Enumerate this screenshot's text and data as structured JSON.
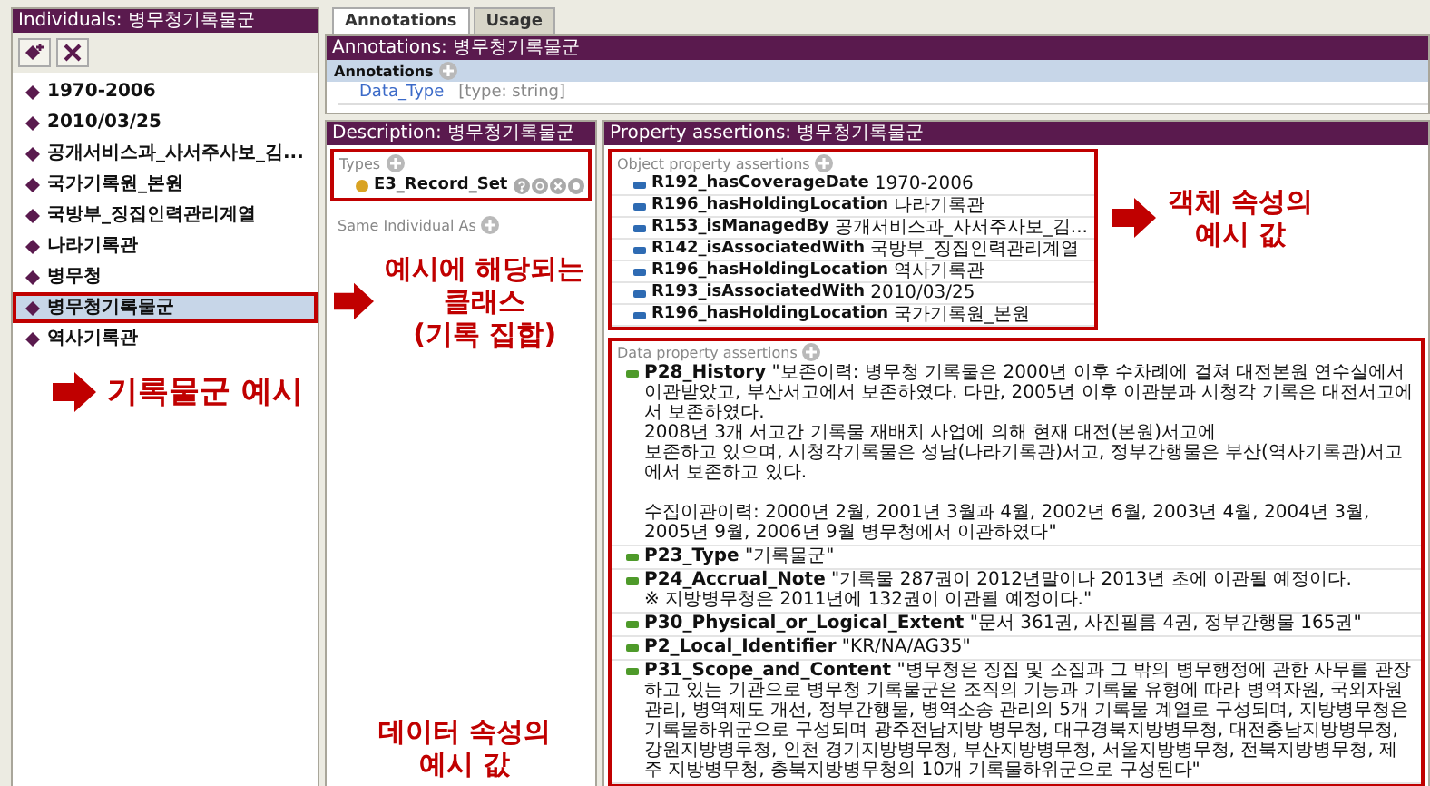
{
  "individuals": {
    "title": "Individuals: 병무청기록물군",
    "frame_selected": true,
    "items": [
      {
        "label": "1970-2006",
        "selected": false
      },
      {
        "label": "2010/03/25",
        "selected": false
      },
      {
        "label": "공개서비스과_사서주사보_김...",
        "selected": false
      },
      {
        "label": "국가기록원_본원",
        "selected": false
      },
      {
        "label": "국방부_징집인력관리계열",
        "selected": false
      },
      {
        "label": "나라기록관",
        "selected": false
      },
      {
        "label": "병무청",
        "selected": false
      },
      {
        "label": "병무청기록물군",
        "selected": true
      },
      {
        "label": "역사기록관",
        "selected": false
      }
    ],
    "callout": {
      "text": "기록물군 예시",
      "arrow": true
    }
  },
  "annotations_view": {
    "tabs": [
      {
        "label": "Annotations",
        "selected": true
      },
      {
        "label": "Usage",
        "selected": false
      }
    ],
    "title": "Annotations: 병무청기록물군",
    "section": "Annotations",
    "rows": [
      {
        "property": "Data_Type",
        "value": "[type: string]"
      }
    ]
  },
  "description": {
    "title": "Description: 병무청기록물군",
    "types": {
      "label": "Types",
      "framed": true,
      "items": [
        "E3_Record_Set"
      ]
    },
    "same_individual": "Same Individual As",
    "callout": {
      "text": "예시에 해당되는\n클래스\n(기록 집합)",
      "arrow": true
    },
    "bottom_callout": {
      "text": "데이터 속성의\n예시 값",
      "arrow": false
    }
  },
  "property_assertions": {
    "title": "Property assertions: 병무청기록물군",
    "object": {
      "label": "Object property assertions",
      "framed": true,
      "rows": [
        {
          "property": "R192_hasCoverageDate",
          "value": "1970-2006"
        },
        {
          "property": "R196_hasHoldingLocation",
          "value": "나라기록관"
        },
        {
          "property": "R153_isManagedBy",
          "value": "공개서비스과_사서주사보_김..."
        },
        {
          "property": "R142_isAssociatedWith",
          "value": "국방부_징집인력관리계열"
        },
        {
          "property": "R196_hasHoldingLocation",
          "value": "역사기록관"
        },
        {
          "property": "R193_isAssociatedWith",
          "value": "2010/03/25"
        },
        {
          "property": "R196_hasHoldingLocation",
          "value": "국가기록원_본원"
        }
      ]
    },
    "object_callout": {
      "text": "객체 속성의\n예시 값",
      "arrow": true
    },
    "data": {
      "label": "Data property assertions",
      "framed": true,
      "rows": [
        "**P28_History** \"보존이력: 병무청 기록물은 2000년 이후 수차례에 걸쳐 대전본원 연수실에서 이관받았고, 부산서고에서 보존하였다. 다만, 2005년 이후 이관분과 시청각 기록은 대전서고에서 보존하였다.\n2008년 3개 서고간 기록물 재배치 사업에 의해 현재 대전(본원)서고에\n보존하고 있으며, 시청각기록물은 성남(나라기록관)서고, 정부간행물은 부산(역사기록관)서고에서 보존하고 있다.\n\n수집이관이력: 2000년 2월, 2001년 3월과 4월, 2002년 6월, 2003년 4월, 2004년 3월, 2005년 9월, 2006년 9월 병무청에서 이관하였다\"",
        "**P23_Type** \"기록물군\"",
        "**P24_Accrual_Note** \"기록물 287권이 2012년말이나 2013년 초에 이관될 예정이다.\n※ 지방병무청은 2011년에 132권이 이관될 예정이다.\"",
        "**P30_Physical_or_Logical_Extent** \"문서 361권, 사진필름 4권, 정부간행물 165권\"",
        "**P2_Local_Identifier** \"KR/NA/AG35\"",
        "**P31_Scope_and_Content** \"병무청은 징집 및 소집과 그 밖의 병무행정에 관한 사무를 관장하고 있는 기관으로 병무청 기록물군은 조직의 기능과 기록물 유형에 따라 병역자원, 국외자원관리, 병역제도 개선, 정부간행물, 병역소송 관리의 5개 기록물 계열로 구성되며, 지방병무청은 기록물하위군으로 구성되며 광주전남지방 병무청, 대구경북지방병무청, 대전충남지방병무청, 강원지방병무청, 인천 경기지방병무청, 부산지방병무청, 서울지방병무청, 전북지방병무청, 제주 지방병무청, 충북지방병무청의 10개 기록물하위군으로 구성된다\""
      ]
    }
  }
}
